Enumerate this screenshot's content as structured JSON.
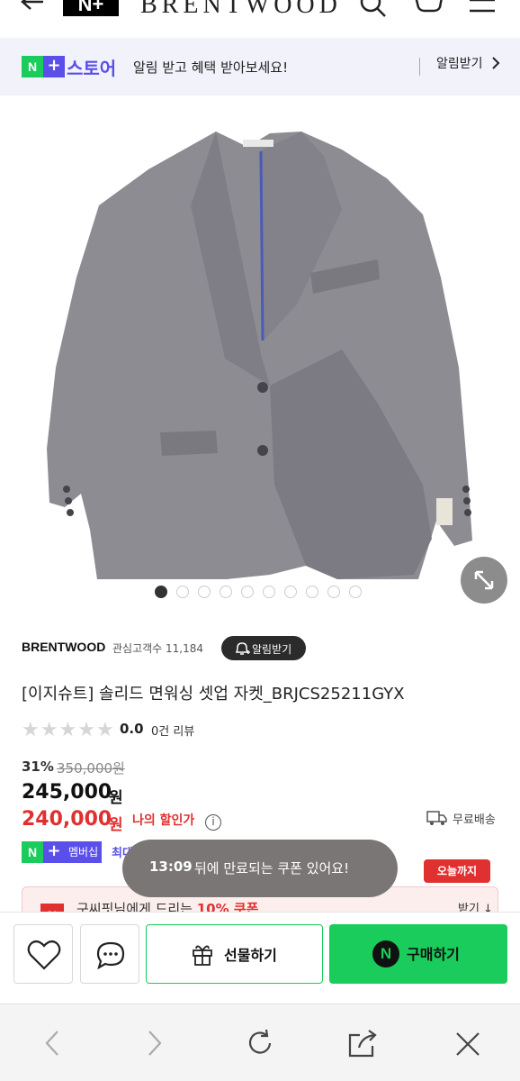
{
  "header": {
    "back_icon": "arrow-left-icon",
    "brand_logo": "N+",
    "brand_name": "BRENTWOOD",
    "icons": [
      "search-icon",
      "cart-icon",
      "menu-icon"
    ]
  },
  "promo": {
    "badge_n": "N",
    "badge_plus": "+",
    "store": "스토어",
    "text": "알림 받고 혜택 받아보세요!",
    "cta": "알림받기"
  },
  "gallery": {
    "total_images": 10,
    "current_index": 1,
    "expand_icon": "expand-icon"
  },
  "product": {
    "seller": "BRENTWOOD",
    "fans": "관심고객수 11,184",
    "alarm_button": "알림받기",
    "title": "[이지슈트] 솔리드 면워싱 셋업 자켓_BRJCS25211GYX",
    "rating": "0.0",
    "rating_stars_filled": 0,
    "reviews": "0건 리뷰",
    "discount": "31%",
    "original_price": "350,000원",
    "price": "245,000",
    "price_unit": "원",
    "my_price": "240,000",
    "my_price_unit": "원",
    "my_price_label": "나의 할인가",
    "shipping": "무료배송",
    "membership_label": "멤버십",
    "membership_text": "최대",
    "today_badge": "오늘까지",
    "coupon_text_pre": "구씨핏님에게 드리는 ",
    "coupon_text_bold": "10% 쿠폰",
    "coupon_action": "받기"
  },
  "toast": {
    "time": "13:09",
    "message": "뒤에 만료되는 쿠폰 있어요!"
  },
  "actions": {
    "gift": "선물하기",
    "buy": "구매하기",
    "buy_badge": "N"
  },
  "browser": {
    "icons": [
      "back-icon",
      "forward-icon",
      "refresh-icon",
      "share-icon",
      "close-icon"
    ]
  },
  "colors": {
    "naver_green": "#19cc5b",
    "plus_purple": "#5a4fe8",
    "sale_red": "#e0302f",
    "promo_bg": "#f2f2fb"
  }
}
